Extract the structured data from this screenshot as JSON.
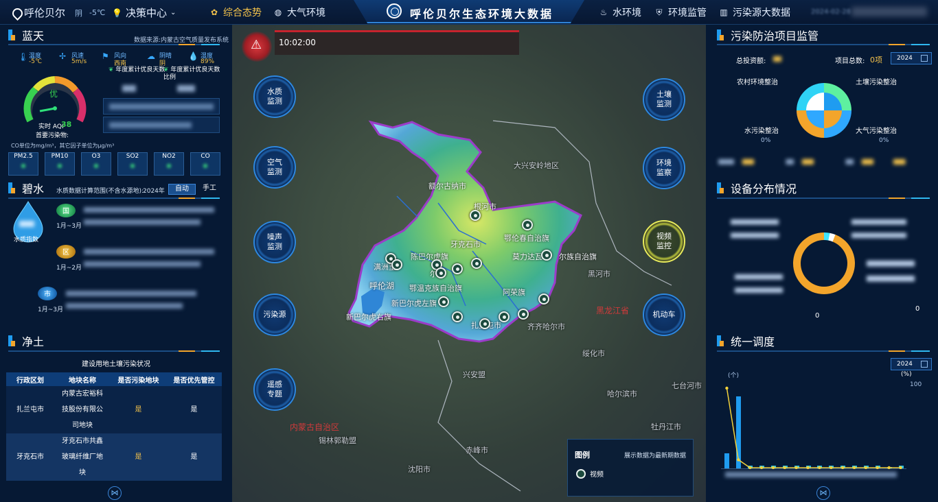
{
  "top": {
    "city": "呼伦贝尔",
    "weather_desc": "阴",
    "weather_temp": "-5℃",
    "decision": "决策中心",
    "nav_overview": "综合态势",
    "nav_air": "大气环境",
    "title": "呼伦贝尔生态环境大数据",
    "nav_water": "水环境",
    "nav_monitor": "环境监管",
    "nav_source": "污染源大数据",
    "clock_date": "2024-02-28"
  },
  "sky": {
    "title": "蓝天",
    "source": "数据来源:内蒙古空气质量发布系统",
    "temp_label": "温度",
    "temp_val": "-5℃",
    "wind_label": "风速",
    "wind_val": "5m/s",
    "winddir_label": "风向",
    "winddir_val": "西南",
    "weather_label": "阴晴",
    "weather_val": "阴",
    "hum_label": "湿度",
    "hum_val": "89%",
    "annual_days_label": "年度累计优良天数",
    "annual_ratio_label": "年度累计优良天数比例",
    "aqi_grade": "优",
    "aqi_label": "实时 AQI",
    "aqi_value": "38",
    "primary_label": "首要污染物:",
    "unit_note": "CO单位为mg/m³，其它因子单位为μg/m³",
    "pollutants": [
      "PM2.5",
      "PM10",
      "O3",
      "SO2",
      "NO2",
      "CO"
    ]
  },
  "water": {
    "title": "碧水",
    "range_label": "水质数据计算范围(不含水源地):",
    "range_year": "2024年",
    "auto_label": "自动",
    "manual_label": "手工",
    "drop_label": "水质指数",
    "badge1": "国",
    "period1": "1月~3月",
    "badge2": "区",
    "period2": "1月~2月",
    "badge3": "市",
    "period3": "1月~3月"
  },
  "soil": {
    "title": "净土",
    "table_title": "建设用地土壤污染状况",
    "headers": [
      "行政区划",
      "地块名称",
      "是否污染地块",
      "是否优先管控"
    ],
    "rows": [
      {
        "region": "扎兰屯市",
        "name": [
          "内蒙古宏裕科",
          "技股份有限公",
          "司地块"
        ],
        "polluted": "是",
        "priority": "是"
      },
      {
        "region": "牙克石市",
        "name": [
          "牙克石市共鑫",
          "玻璃纤维厂地",
          "块"
        ],
        "polluted": "是",
        "priority": "是"
      }
    ]
  },
  "map": {
    "alarm_time": "10:02:00",
    "btn_left": [
      "水质监测",
      "空气监测",
      "噪声监测",
      "污染源",
      "遥感专题"
    ],
    "btn_right": [
      "土壤监测",
      "环境监察",
      "视频监控",
      "机动车"
    ],
    "places": {
      "dxal": "大兴安岭地区",
      "eergn": "额尔古纳市",
      "genhe": "根河市",
      "ekssk": "鄂伦春自治旗",
      "yks": "牙克石市",
      "cbeh": "陈巴尔虎旗",
      "mzl": "满洲里",
      "hlh": "呼伦湖",
      "ewk": "鄂温克族自治旗",
      "xbeh_z": "新巴尔虎左旗",
      "xbeh_y": "新巴尔虎右旗",
      "mldw": "莫力达瓦",
      "dwz": "尔族自治旗",
      "arg": "阿荣旗",
      "zlt": "扎兰屯市",
      "heihe": "黑河市",
      "qqhe": "齐齐哈尔市",
      "suihua": "绥化市",
      "xam": "兴安盟",
      "hrb": "哈尔滨市",
      "qth": "七台河市",
      "mdj": "牡丹江市",
      "nmg": "内蒙古自治区",
      "xlgl": "锡林郭勒盟",
      "hl": "黑龙江省",
      "sy": "沈阳市",
      "cbs": "赤峰市",
      "er": "尔"
    },
    "legend_title": "图例",
    "legend_note": "展示数据为最新期数据",
    "legend_item": "视频"
  },
  "project": {
    "title": "污染防治项目监管",
    "invest_label": "总投资额:",
    "count_label": "项目总数:",
    "count_val": "0项",
    "year": "2024",
    "labels": [
      "农村环境整治",
      "土壤污染整治",
      "水污染整治",
      "大气污染整治"
    ],
    "zero_pct": "0%"
  },
  "device": {
    "title": "设备分布情况",
    "axis_zero_l": "0",
    "axis_zero_r": "0"
  },
  "dispatch": {
    "title": "统一调度",
    "year": "2024",
    "y_left_unit": "(个)",
    "y_right_unit": "(%)",
    "y_right_max": "100"
  },
  "chart_data": {
    "type": "bar",
    "values": [
      18,
      85,
      3,
      3,
      3,
      3,
      3,
      3,
      3,
      3,
      3,
      3,
      3,
      3,
      2,
      3
    ],
    "line": [
      100,
      10,
      0,
      0,
      0,
      0,
      0,
      0,
      0,
      0,
      0,
      0,
      0,
      0,
      0,
      0
    ],
    "ylabel": "(个)",
    "y2label": "(%)"
  }
}
